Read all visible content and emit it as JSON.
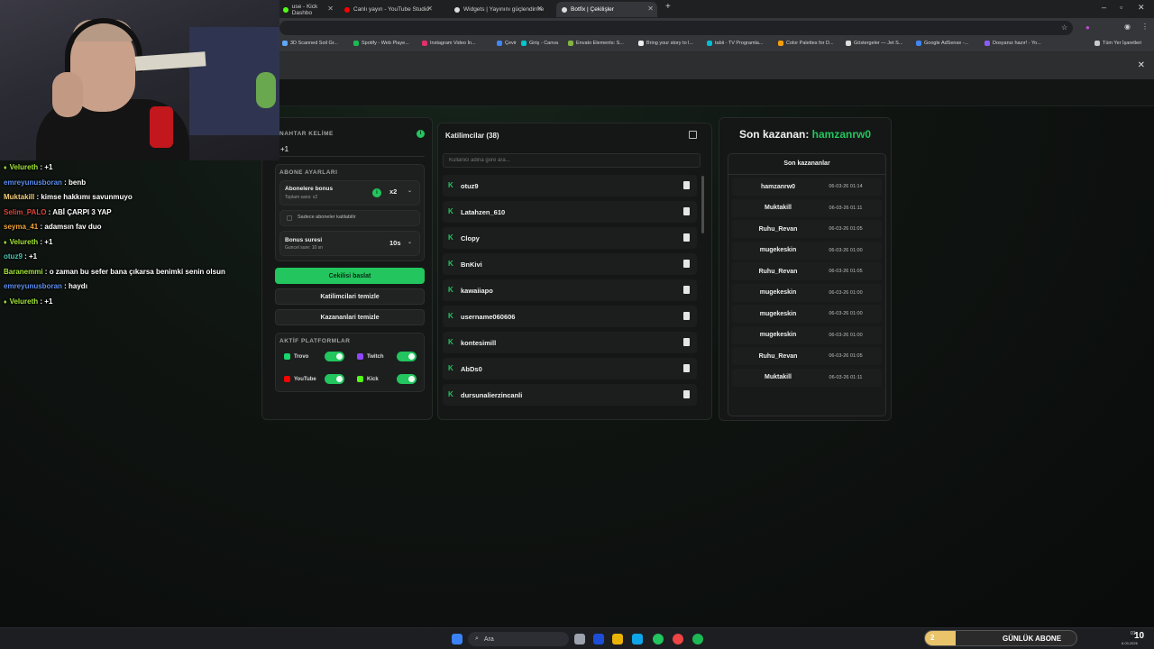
{
  "browser": {
    "tabs": [
      {
        "label": "use - Kick Dashbo",
        "color": "#53fc18"
      },
      {
        "label": "Canlı yayın - YouTube Studio",
        "color": "#ff0000"
      },
      {
        "label": "Widgets | Yayınını güçlendirme",
        "color": "#dddddd"
      },
      {
        "label": "Botfix | Çekilişler",
        "color": "#dddddd"
      }
    ],
    "bookmarks": [
      "3D Scanned Soil Gr...",
      "Spotify - Web Playe...",
      "Instagram Video İn...",
      "Çevir",
      "Giriş - Canva",
      "Envato Elements: S...",
      "Bring your story to l...",
      "tabii - TV Programla...",
      "Color Palettes for D...",
      "Göstergeler — Jet S...",
      "Google AdSense -...",
      "Dosyanız hazır! - Yo...",
      "Tüm Yer İşaretleri"
    ]
  },
  "chat": [
    {
      "user": "Velureth",
      "msg": "+1",
      "color": "#a3e635",
      "dot": true
    },
    {
      "user": "emreyunusboran",
      "msg": "benb",
      "color": "#5b8def",
      "dot": false
    },
    {
      "user": "Muktakill",
      "msg": "kimse hakkımı savunmuyo",
      "color": "#f5d07a",
      "dot": false
    },
    {
      "user": "Selim_PALO",
      "msg": "ABİ ÇARPI 3 YAP",
      "color": "#e0443a",
      "dot": false
    },
    {
      "user": "seyma_41",
      "msg": "adamsın fav duo",
      "color": "#f0a43c",
      "dot": false
    },
    {
      "user": "Velureth",
      "msg": "+1",
      "color": "#a3e635",
      "dot": true
    },
    {
      "user": "otuz9",
      "msg": "+1",
      "color": "#48c9b0",
      "dot": false
    },
    {
      "user": "Baranemmi",
      "msg": "o zaman bu sefer bana çıkarsa benimki senin olsun",
      "color": "#a3e635",
      "dot": false
    },
    {
      "user": "emreyunusboran",
      "msg": "haydı",
      "color": "#5b8def",
      "dot": false
    },
    {
      "user": "Velureth",
      "msg": "+1",
      "color": "#a3e635",
      "dot": true
    }
  ],
  "settings": {
    "keyword_label": "NAHTAR KELİME",
    "keyword_value": "+1",
    "sub_section": "ABONE AYARLARI",
    "sub_bonus_title": "Abonelere bonus",
    "sub_bonus_sub": "Toplam sans: x2",
    "sub_bonus_value": "x2",
    "only_subs": "Sadece aboneler katilabilir",
    "bonus_time_title": "Bonus suresi",
    "bonus_time_sub": "Guncel sure: 10 sn",
    "bonus_time_value": "10s",
    "start_btn": "Cekilisi baslat",
    "clear_participants": "Katilimcilari temizle",
    "clear_winners": "Kazananlari temizle",
    "platforms_label": "AKTİF PLATFORMLAR",
    "platforms": [
      {
        "name": "Trovo",
        "color": "#19d66b"
      },
      {
        "name": "Twitch",
        "color": "#9146ff"
      },
      {
        "name": "YouTube",
        "color": "#ff0000"
      },
      {
        "name": "Kick",
        "color": "#53fc18"
      }
    ]
  },
  "participants": {
    "title": "Katilimcilar (38)",
    "search_placeholder": "Kullanici adina gore ara...",
    "names": [
      "otuz9",
      "Latahzen_610",
      "Clopy",
      "BnKivi",
      "kawaiiapo",
      "username060606",
      "kontesimill",
      "AbDs0",
      "dursunalierzincanli"
    ]
  },
  "winners": {
    "heading": "Son kazanan:",
    "last_winner": "hamzanrw0",
    "list_title": "Son kazananlar",
    "rows": [
      {
        "name": "hamzanrw0",
        "date": "06-03-26 01:14"
      },
      {
        "name": "Muktakill",
        "date": "06-03-26 01:11"
      },
      {
        "name": "Ruhu_Revan",
        "date": "06-03-26 01:05"
      },
      {
        "name": "mugekeskin",
        "date": "06-03-26 01:00"
      },
      {
        "name": "Ruhu_Revan",
        "date": "06-03-26 01:05"
      },
      {
        "name": "mugekeskin",
        "date": "06-03-26 01:00"
      },
      {
        "name": "mugekeskin",
        "date": "06-03-26 01:00"
      },
      {
        "name": "mugekeskin",
        "date": "06-03-26 01:00"
      },
      {
        "name": "Ruhu_Revan",
        "date": "06-03-26 01:05"
      },
      {
        "name": "Muktakill",
        "date": "06-03-26 01:11"
      }
    ]
  },
  "taskbar": {
    "search": "Ara",
    "goal_current": "2",
    "goal_text": "GÜNLÜK ABONE",
    "goal_target": "10",
    "goal_fraction": 0.2,
    "clock": "01:",
    "date": "6.03.2026"
  }
}
